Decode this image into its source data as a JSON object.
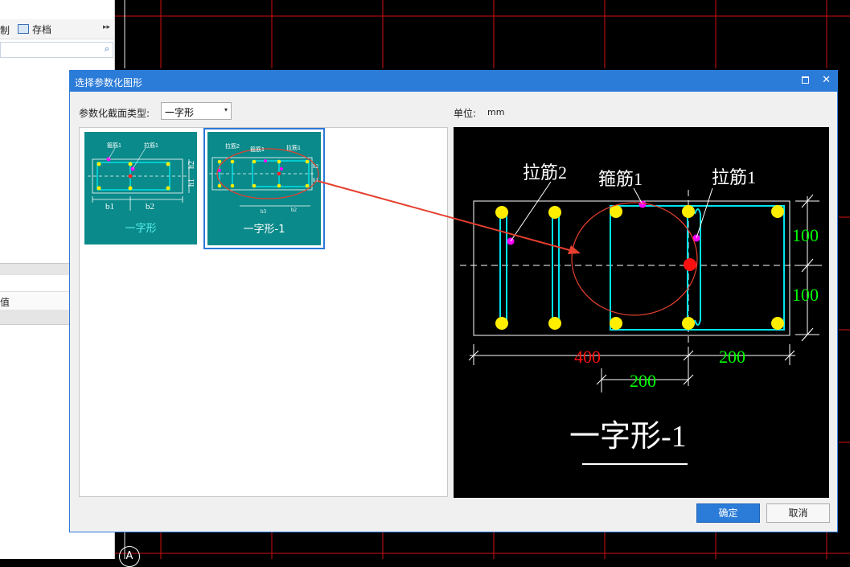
{
  "background": {
    "toolbar": {
      "cut_label": "制",
      "save_label": "存档",
      "more_glyph": "▸▸"
    },
    "search_icon": "⌕",
    "row_label": "值",
    "axis_bubble": "A"
  },
  "dialog": {
    "title": "选择参数化图形",
    "maximize_glyph": "□",
    "close_glyph": "✕",
    "section_type_label": "参数化截面类型:",
    "section_type_value": "一字形",
    "select_arrow": "▾",
    "unit_label": "单位:",
    "unit_value": "mm",
    "thumbnails": [
      {
        "caption": "一字形",
        "labels": {
          "stirrup": "箍筋1",
          "tie1": "拉筋1",
          "b1": "b1",
          "b2": "b2",
          "h1": "h1",
          "h2": "h2"
        },
        "selected": false
      },
      {
        "caption": "一字形-1",
        "labels": {
          "tie2": "拉筋2",
          "stirrup": "箍筋1",
          "tie1": "拉筋1",
          "b3": "b3",
          "b2": "b2",
          "h1": "h1",
          "h2": "h2"
        },
        "selected": true
      }
    ],
    "preview": {
      "labels": {
        "tie2": "拉筋2",
        "stirrup": "箍筋1",
        "tie1": "拉筋1"
      },
      "dimensions": {
        "h2": "100",
        "h1": "100",
        "b_total": "400",
        "b2": "200",
        "b3": "200"
      },
      "title": "一字形-1"
    },
    "ok_label": "确定",
    "cancel_label": "取消"
  },
  "colors": {
    "dialog_titlebar": "#2b7bd8",
    "thumb_bg": "#0a8a8a",
    "rebar_yellow": "#ffee00",
    "rebar_cyan": "#00e5ee",
    "tie_magenta": "#ff00ff",
    "dim_red": "#ff0000",
    "dim_green": "#00ff00",
    "annotation_red": "#e5402f"
  }
}
